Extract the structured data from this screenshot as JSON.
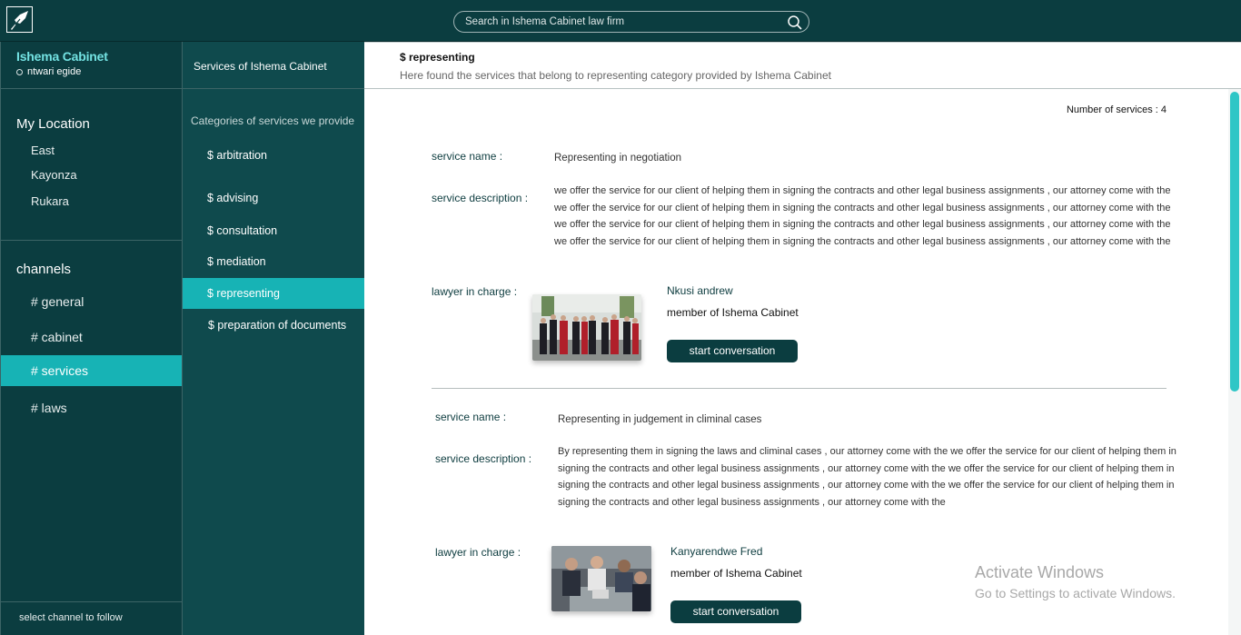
{
  "search": {
    "placeholder": "Search in Ishema Cabinet law firm"
  },
  "workspace": {
    "name": "Ishema Cabinet",
    "user": "ntwari egide"
  },
  "location": {
    "title": "My Location",
    "items": [
      "East",
      "Kayonza",
      "Rukara"
    ]
  },
  "channels": {
    "title": "channels",
    "items": [
      "# general",
      "# cabinet",
      "# services",
      "# laws"
    ],
    "active": "# services"
  },
  "sidebar_footer": "select  channel to follow",
  "categories": {
    "header": "Services of Ishema Cabinet",
    "subtitle": "Categories of services we provide",
    "items": [
      "$ arbitration",
      "$ advising",
      "$ consultation",
      "$ mediation",
      "$ representing",
      "$ preparation of documents"
    ],
    "active": "$ representing"
  },
  "main": {
    "title": "$ representing",
    "description": "Here found the services that belong to representing category provided by Ishema Cabinet",
    "count": "Number of services : 4",
    "labels": {
      "service_name": "service name   :",
      "service_description": "service description :",
      "lawyer": "lawyer in charge :"
    },
    "button_label": "start conversation",
    "services": [
      {
        "name": "Representing in negotiation",
        "description": "we offer the service for our client of helping them in signing the contracts and other legal business assignments , our attorney come with the we offer the service for our client of helping them in signing the contracts and other legal business assignments , our attorney come with the we offer the service for our client of helping them in signing the contracts and other legal business assignments , our attorney come with the we offer the service for our client of helping them in signing the contracts and other legal business assignments , our attorney come with the",
        "lawyer_name": "Nkusi andrew",
        "lawyer_role": "member of Ishema Cabinet"
      },
      {
        "name": "Representing in judgement in climinal cases",
        "description": "By representing them in signing the laws and climinal cases , our attorney come with the we offer the service for our client of helping them in signing the contracts and other legal business assignments , our attorney come with the we offer the service for our client of helping them in signing the contracts and other legal business assignments , our attorney come with the we offer the service for our client of helping them in signing the contracts and other legal business assignments , our attorney come with the",
        "lawyer_name": "Kanyarendwe Fred",
        "lawyer_role": "member of Ishema Cabinet"
      }
    ]
  },
  "watermark": {
    "title": "Activate Windows",
    "subtitle": "Go to Settings to activate Windows."
  },
  "colors": {
    "primary": "#0b3d40",
    "accent": "#17b3b5",
    "panel": "#0f4a4d"
  }
}
